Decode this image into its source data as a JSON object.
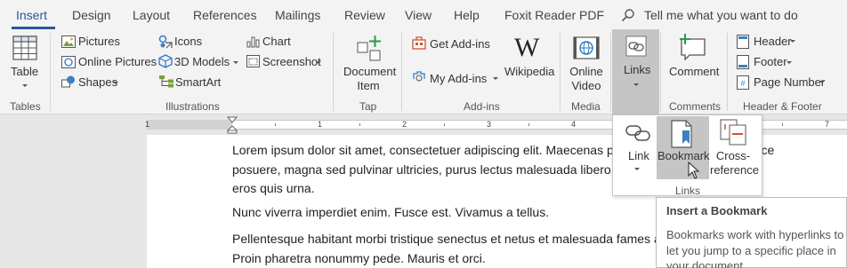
{
  "tabs": [
    {
      "label": "Insert"
    },
    {
      "label": "Design"
    },
    {
      "label": "Layout"
    },
    {
      "label": "References"
    },
    {
      "label": "Mailings"
    },
    {
      "label": "Review"
    },
    {
      "label": "View"
    },
    {
      "label": "Help"
    },
    {
      "label": "Foxit Reader PDF"
    }
  ],
  "tell_me": "Tell me what you want to do",
  "groups": {
    "tables": {
      "label": "Tables",
      "table": "Table"
    },
    "illustrations": {
      "label": "Illustrations",
      "pictures": "Pictures",
      "online_pictures": "Online Pictures",
      "shapes": "Shapes",
      "icons": "Icons",
      "models_3d": "3D Models",
      "smartart": "SmartArt",
      "chart": "Chart",
      "screenshot": "Screenshot"
    },
    "tap": {
      "label": "Tap",
      "document_item_1": "Document",
      "document_item_2": "Item"
    },
    "addins": {
      "label": "Add-ins",
      "get_addins": "Get Add-ins",
      "my_addins": "My Add-ins",
      "wikipedia": "Wikipedia"
    },
    "media": {
      "label": "Media",
      "online_video_1": "Online",
      "online_video_2": "Video"
    },
    "links": {
      "label": "Links"
    },
    "comments": {
      "label": "Comments",
      "comment": "Comment"
    },
    "header_footer": {
      "label": "Header & Footer",
      "header": "Header",
      "footer": "Footer",
      "page_number": "Page Number"
    }
  },
  "ruler": [
    "1",
    "1",
    "2",
    "3",
    "4",
    "5",
    "6",
    "7"
  ],
  "document": {
    "p1": "Lorem ipsum dolor sit amet, consectetuer adipiscing elit. Maecenas porttitor congue massa. Fusce posuere, magna sed pulvinar ultricies, purus lectus malesuada libero, sit amet commodo magna eros quis urna.",
    "p2": "Nunc viverra imperdiet enim. Fusce est. Vivamus a tellus.",
    "p3": "Pellentesque habitant morbi tristique senectus et netus et malesuada fames ac turpis egestas. Proin pharetra nonummy pede. Mauris et orci."
  },
  "links_dropdown": {
    "link": "Link",
    "bookmark": "Bookmark",
    "cross_reference_1": "Cross-",
    "cross_reference_2": "reference",
    "group_label": "Links"
  },
  "tooltip": {
    "title": "Insert a Bookmark",
    "body": "Bookmarks work with hyperlinks to let you jump to a specific place in your document."
  },
  "colors": {
    "accent": "#2b579a",
    "highlight": "#c5c5c5"
  }
}
